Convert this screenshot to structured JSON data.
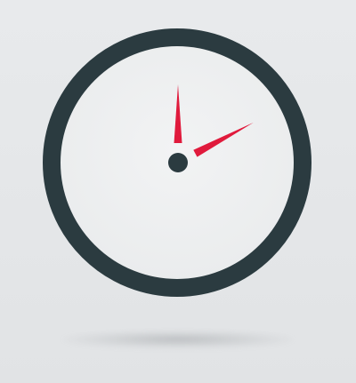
{
  "icon": {
    "name": "clock-icon",
    "hour_hand_angle_deg": 0,
    "minute_hand_angle_deg": 62
  },
  "colors": {
    "background": "#e6e8ea",
    "ring": "#2b3b40",
    "face": "#eef0f1",
    "hands": "#e01a3c",
    "pivot": "#2b3b40"
  }
}
